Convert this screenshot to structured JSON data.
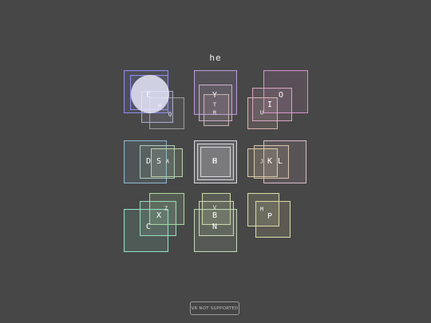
{
  "typed_text": "he",
  "vr_button_label": "VR NOT SUPPORTED",
  "keys": {
    "q": "Q",
    "w": "W",
    "e": "E",
    "r": "R",
    "t": "T",
    "y": "Y",
    "u": "U",
    "i": "I",
    "o": "O",
    "a": "A",
    "s": "S",
    "d": "D",
    "f": "F",
    "g": "G",
    "h": "H",
    "j": "J",
    "k": "K",
    "l": "L",
    "z": "Z",
    "x": "X",
    "c": "C",
    "v": "V",
    "b": "B",
    "n": "N",
    "m": "M",
    "p": "P"
  },
  "colors": {
    "background": "#474747",
    "group_top_left": "#8e8cf0",
    "group_top_center": "#b89bd8",
    "group_top_right": "#d38fd0",
    "group_middle_left": "#8ab6d0",
    "group_center": "#d6d6dc",
    "group_middle_right": "#d8b8c8",
    "group_bottom_left": "#8ee0c8",
    "group_bottom_center": "#c0d8b8",
    "group_bottom_right": "#d8d8a0",
    "hand_cursor": "#ececff"
  }
}
